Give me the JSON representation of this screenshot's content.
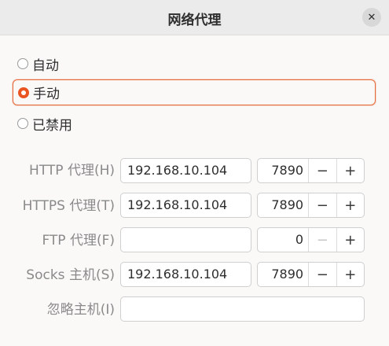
{
  "window": {
    "title": "网络代理",
    "close_icon": "close-icon"
  },
  "modes": [
    {
      "label": "自动",
      "selected": false
    },
    {
      "label": "手动",
      "selected": true
    },
    {
      "label": "已禁用",
      "selected": false
    }
  ],
  "proxies": {
    "http": {
      "label": "HTTP 代理(H)",
      "host": "192.168.10.104",
      "port": "7890"
    },
    "https": {
      "label": "HTTPS 代理(T)",
      "host": "192.168.10.104",
      "port": "7890"
    },
    "ftp": {
      "label": "FTP 代理(F)",
      "host": "",
      "port": "0"
    },
    "socks": {
      "label": "Socks 主机(S)",
      "host": "192.168.10.104",
      "port": "7890"
    },
    "ignore": {
      "label": "忽略主机(I)",
      "host": ""
    }
  },
  "stepper": {
    "minus": "−",
    "plus": "+"
  },
  "colors": {
    "accent": "#e95420",
    "focus_border": "#e66b3a"
  }
}
